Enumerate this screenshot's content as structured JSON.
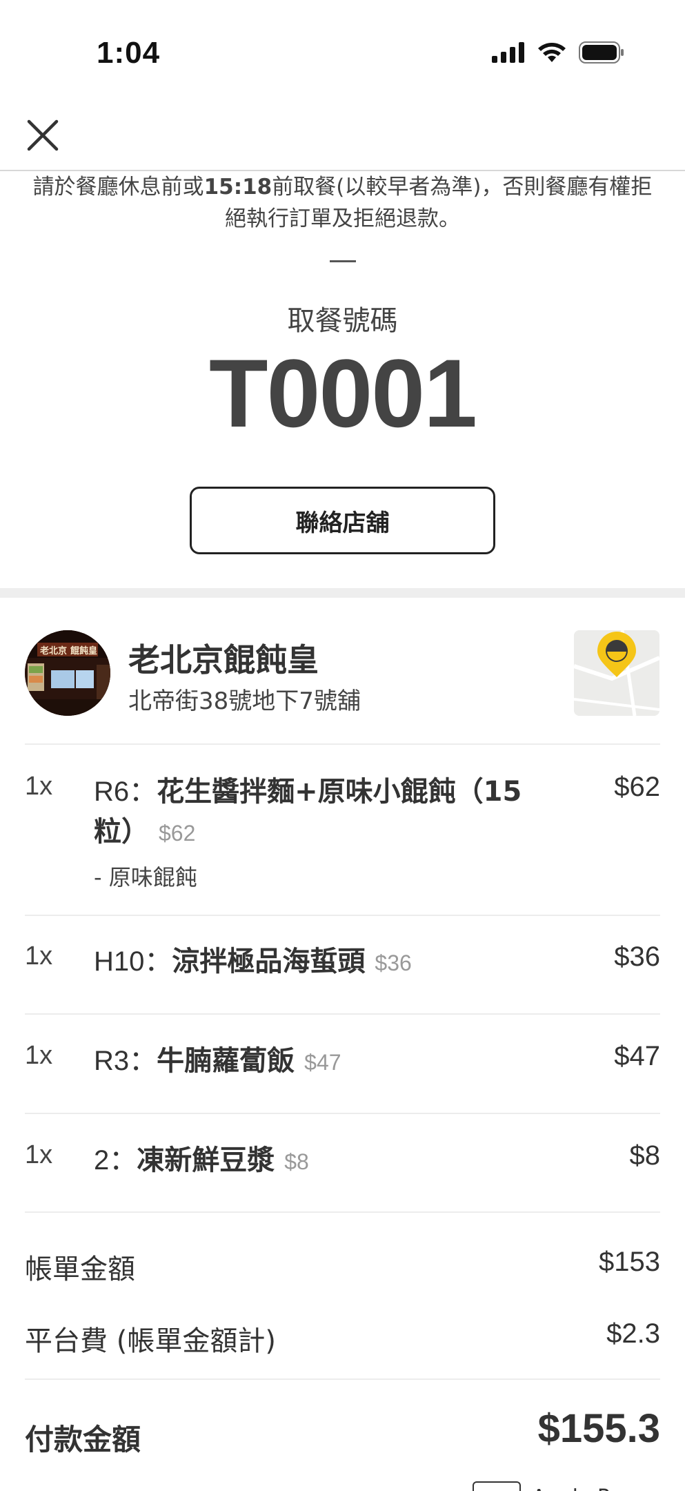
{
  "status_bar": {
    "time": "1:04"
  },
  "notice": {
    "prefix": "請於餐廳休息前或",
    "time": "15:18",
    "suffix": "前取餐(以較早者為準)，否則餐廳有權拒絕執行訂單及拒絕退款。"
  },
  "pickup": {
    "label": "取餐號碼",
    "number": "T0001",
    "contact_button_label": "聯絡店舖"
  },
  "restaurant": {
    "name": "老北京餛飩皇",
    "address": "北帝街38號地下7號舖",
    "avatar_sign_text_1": "老北京",
    "avatar_sign_text_2": "餛飩皇"
  },
  "items": [
    {
      "qty": "1x",
      "code": "R6：",
      "name": "花生醬拌麵+原味小餛飩（15粒）",
      "unit_price": "$62",
      "option": "- 原味餛飩",
      "price": "$62"
    },
    {
      "qty": "1x",
      "code": "H10：",
      "name": "涼拌極品海蜇頭",
      "unit_price": "$36",
      "option": "",
      "price": "$36"
    },
    {
      "qty": "1x",
      "code": "R3：",
      "name": "牛腩蘿蔔飯",
      "unit_price": "$47",
      "option": "",
      "price": "$47"
    },
    {
      "qty": "1x",
      "code": "2：",
      "name": "凍新鮮豆漿",
      "unit_price": "$8",
      "option": "",
      "price": "$8"
    }
  ],
  "totals": {
    "subtotal_label": "帳單金額",
    "subtotal_value": "$153",
    "platform_fee_label": "平台費 (帳單金額計)",
    "platform_fee_value": "$2.3",
    "payment_label": "付款金額",
    "payment_value": "$155.3"
  },
  "payment_method": {
    "label": "Apple Pay"
  },
  "colors": {
    "text": "#333333",
    "muted": "#999999",
    "divider": "#ececec",
    "map_pin": "#f5c518"
  },
  "icons": [
    "signal-icon",
    "wifi-icon",
    "battery-icon",
    "close-icon",
    "map-pin-icon"
  ]
}
